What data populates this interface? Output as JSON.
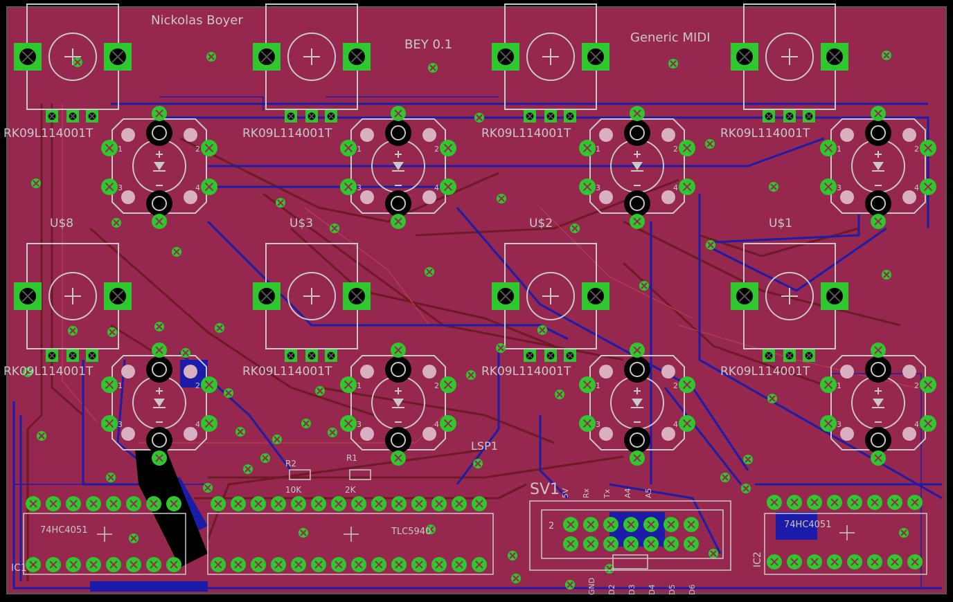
{
  "board": {
    "colors": {
      "background": "#000000",
      "copper_top": "#96284f",
      "copper_top_trace": "#7a1f2a",
      "copper_bottom": "#1c1ca8",
      "pad": "#2ec82e",
      "silkscreen": "#c8c8c8",
      "drill": "#000000"
    },
    "labels": {
      "author": "Nickolas Boyer",
      "version": "BEY 0.1",
      "project": "Generic MIDI"
    },
    "knobs": [
      {
        "part": "RK09L114001T"
      },
      {
        "part": "RK09L114001T"
      },
      {
        "part": "RK09L114001T"
      },
      {
        "part": "RK09L114001T"
      },
      {
        "part": "RK09L114001T"
      },
      {
        "part": "RK09L114001T"
      },
      {
        "part": "RK09L114001T"
      },
      {
        "part": "RK09L114001T"
      }
    ],
    "buttons": [
      {
        "ref": "U$8"
      },
      {
        "ref": "U$3"
      },
      {
        "ref": "U$2"
      },
      {
        "ref": "U$1"
      }
    ],
    "button_pin_labels": [
      "1",
      "2",
      "3",
      "4"
    ],
    "chips": {
      "mux_left": "74HC4051",
      "mux_right": "74HC4051",
      "pwm": "TLC5940",
      "ic2": "IC2",
      "ic_left": "IC1"
    },
    "resistors": [
      {
        "ref": "R2",
        "value": "10K"
      },
      {
        "ref": "R1",
        "value": "2K"
      }
    ],
    "misc": {
      "speaker": "LSP1",
      "header": "SV1",
      "header_pin": "2",
      "header_pins_top": [
        "5V",
        "Rx",
        "Tx",
        "A4",
        "A5"
      ],
      "header_pins_bottom": [
        "GND",
        "D2",
        "D3",
        "D4",
        "D5",
        "D6"
      ]
    }
  }
}
